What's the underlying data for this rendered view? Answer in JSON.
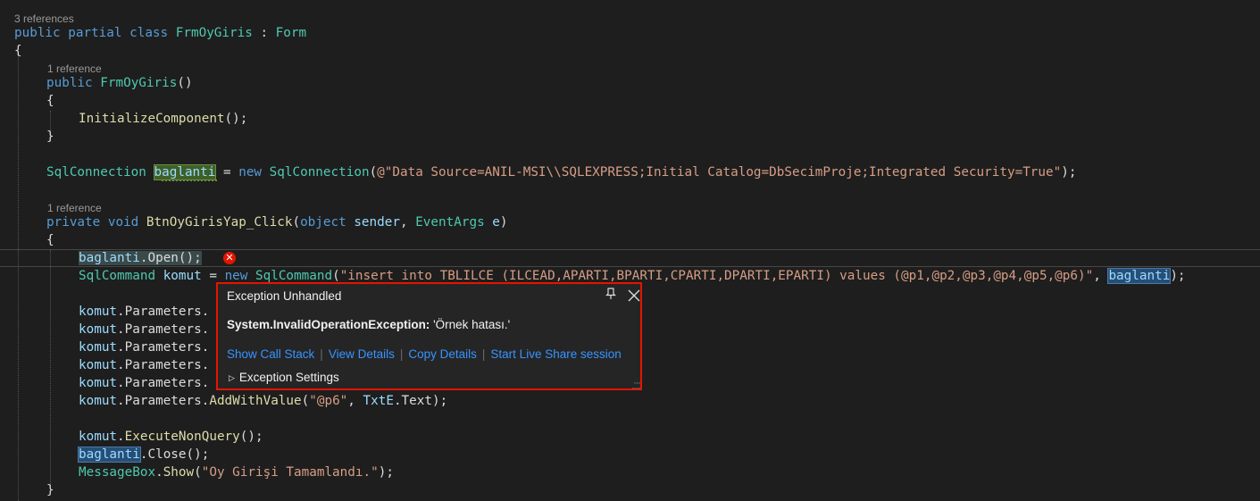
{
  "code": {
    "refs_class": "3 references",
    "refs_ctor": "1 reference",
    "refs_method": "1 reference",
    "class_kw": "public partial class",
    "class_name": "FrmOyGiris",
    "colon": " : ",
    "base_class": "Form",
    "brace_open": "{",
    "brace_close": "}",
    "ctor_kw": "public",
    "ctor_name": "FrmOyGiris",
    "parens": "()",
    "init_call": "InitializeComponent",
    "call_end": "();",
    "conn_type": "SqlConnection",
    "conn_var": "baglanti",
    "eq": " = ",
    "new_kw": "new",
    "conn_open": "(",
    "conn_string": "@\"Data Source=ANIL-MSI\\\\SQLEXPRESS;Initial Catalog=DbSecimProje;Integrated Security=True\"",
    "conn_close": ");",
    "method_mods": "private void",
    "method_name": "BtnOyGirisYap_Click",
    "p_open": "(",
    "obj_kw": "object",
    "sender": "sender",
    "comma": ", ",
    "eventargs": "EventArgs",
    "e": "e",
    "p_close": ")",
    "open_var": "baglanti",
    "open_call": ".Open();",
    "cmd_type": "SqlCommand",
    "cmd_var": "komut",
    "cmd_eq": " = ",
    "cmd_new": "new",
    "cmd_type2": "SqlCommand",
    "cmd_str": "\"insert into TBLILCE (ILCEAD,APARTI,BPARTI,CPARTI,DPARTI,EPARTI) values (@p1,@p2,@p3,@p4,@p5,@p6)\"",
    "cmd_arg_var": "baglanti",
    "cmd_end": ");",
    "komut": "komut",
    "params_prefix": ".Parameters.",
    "params_cut": ".Parameters.",
    "add_with_value": "AddWithValue",
    "p6_str": "\"@p6\"",
    "txte": "TxtE",
    "text_end": ".Text);",
    "exec_call": "ExecuteNonQuery",
    "close_var": "baglanti",
    "close_call": ".Close();",
    "msgbox": "MessageBox",
    "show": "Show",
    "msg_str": "\"Oy Girişi Tamamlandı.\""
  },
  "exception_popup": {
    "title": "Exception Unhandled",
    "exception_type": "System.InvalidOperationException:",
    "exception_message": " 'Örnek hatası.'",
    "links": [
      "Show Call Stack",
      "View Details",
      "Copy Details",
      "Start Live Share session"
    ],
    "settings_label": "Exception Settings",
    "pin_icon": "pin-icon",
    "close_icon": "close-icon"
  },
  "colors": {
    "error_border": "#e51400",
    "link": "#3794ff",
    "keyword": "#569cd6",
    "type": "#4ec9b0",
    "string": "#d69d85"
  }
}
